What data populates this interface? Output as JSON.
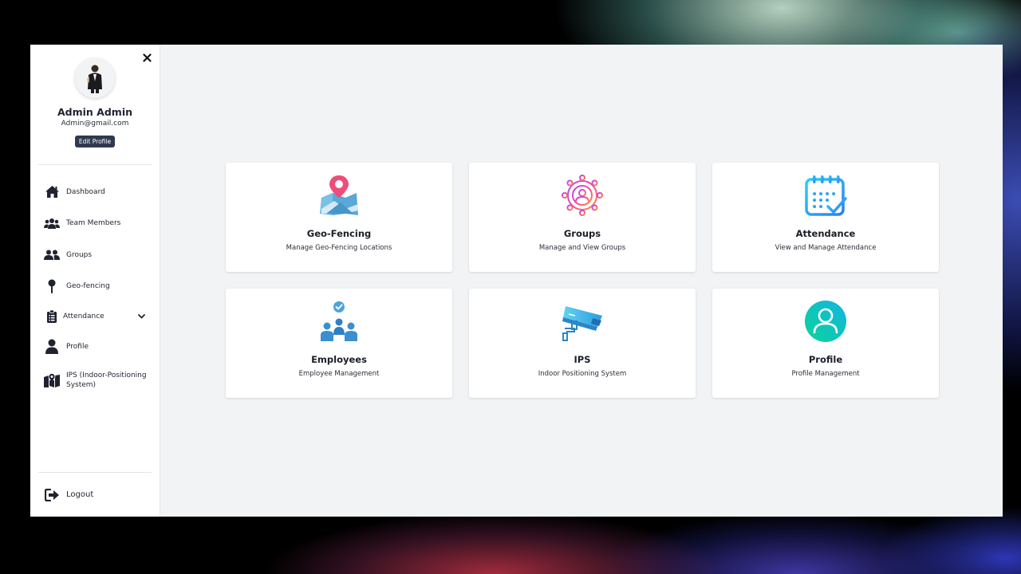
{
  "user": {
    "name": "Admin Admin",
    "email": "Admin@gmail.com",
    "edit_label": "Edit Profile"
  },
  "sidebar": {
    "items": [
      {
        "label": "Dashboard",
        "icon": "home-icon"
      },
      {
        "label": "Team Members",
        "icon": "users-icon"
      },
      {
        "label": "Groups",
        "icon": "user-group-icon"
      },
      {
        "label": "Geo-fencing",
        "icon": "map-pin-icon"
      },
      {
        "label": "Attendance",
        "icon": "clipboard-icon"
      },
      {
        "label": "Profile",
        "icon": "user-icon"
      },
      {
        "label": "IPS (Indoor-Positioning System)",
        "icon": "map-location-icon"
      }
    ],
    "logout_label": "Logout"
  },
  "cards": [
    {
      "title": "Geo-Fencing",
      "desc": "Manage Geo-Fencing Locations",
      "icon": "map-marker-icon"
    },
    {
      "title": "Groups",
      "desc": "Manage and View Groups",
      "icon": "group-network-icon"
    },
    {
      "title": "Attendance",
      "desc": "View and Manage Attendance",
      "icon": "calendar-check-icon"
    },
    {
      "title": "Employees",
      "desc": "Employee Management",
      "icon": "employees-icon"
    },
    {
      "title": "IPS",
      "desc": "Indoor Positioning System",
      "icon": "cctv-camera-icon"
    },
    {
      "title": "Profile",
      "desc": "Profile Management",
      "icon": "profile-circle-icon"
    }
  ],
  "colors": {
    "sidebar_bg": "#ffffff",
    "main_bg": "#f2f3f5",
    "edit_button_bg": "#2f3a4f",
    "text_primary": "#1f2330"
  }
}
